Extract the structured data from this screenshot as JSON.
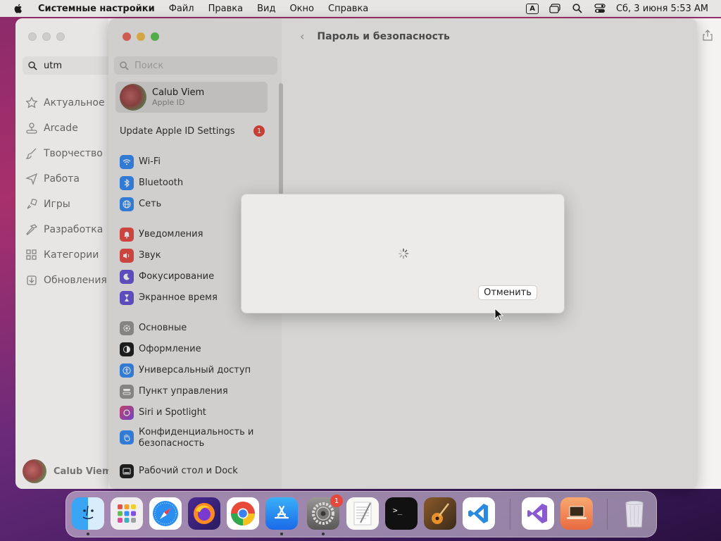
{
  "menubar": {
    "app_name": "Системные настройки",
    "items": [
      "Файл",
      "Правка",
      "Вид",
      "Окно",
      "Справка"
    ],
    "input_badge": "A",
    "datetime": "Сб, 3 июня  5:53 AM"
  },
  "appstore": {
    "search_value": "utm",
    "nav": [
      {
        "label": "Актуальное",
        "icon": "star-icon"
      },
      {
        "label": "Arcade",
        "icon": "joystick-icon"
      },
      {
        "label": "Творчество",
        "icon": "brush-icon"
      },
      {
        "label": "Работа",
        "icon": "paperplane-icon"
      },
      {
        "label": "Игры",
        "icon": "rocket-icon"
      },
      {
        "label": "Разработка",
        "icon": "hammer-icon"
      },
      {
        "label": "Категории",
        "icon": "grid-icon"
      },
      {
        "label": "Обновления",
        "icon": "download-icon"
      }
    ],
    "user_name": "Calub Viem"
  },
  "settings": {
    "search_placeholder": "Поиск",
    "page_title": "Пароль и безопасность",
    "apple_id": {
      "name": "Calub Viem",
      "sub": "Apple ID"
    },
    "update_row": {
      "label": "Update Apple ID Settings",
      "badge": "1"
    },
    "items": [
      {
        "label": "Wi-Fi",
        "color": "#3a8ef5"
      },
      {
        "label": "Bluetooth",
        "color": "#3a8ef5"
      },
      {
        "label": "Сеть",
        "color": "#3a8ef5"
      },
      {
        "label": "Уведомления",
        "color": "#e8504a"
      },
      {
        "label": "Звук",
        "color": "#e8504a"
      },
      {
        "label": "Фокусирование",
        "color": "#6a58d8"
      },
      {
        "label": "Экранное время",
        "color": "#6a58d8"
      },
      {
        "label": "Основные",
        "color": "#9a9896"
      },
      {
        "label": "Оформление",
        "color": "#222222"
      },
      {
        "label": "Универсальный доступ",
        "color": "#3a8ef5"
      },
      {
        "label": "Пункт управления",
        "color": "#9a9896"
      },
      {
        "label": "Siri и Spotlight",
        "color": "#c050c8"
      },
      {
        "label": "Конфиденциальность и безопасность",
        "label_line1": "Конфиденциальность и",
        "label_line2": "безопасность",
        "color": "#3a8ef5"
      },
      {
        "label": "Рабочий стол и Dock",
        "color": "#222222"
      }
    ]
  },
  "sheet": {
    "cancel_label": "Отменить"
  },
  "dock": {
    "settings_badge": "1"
  }
}
